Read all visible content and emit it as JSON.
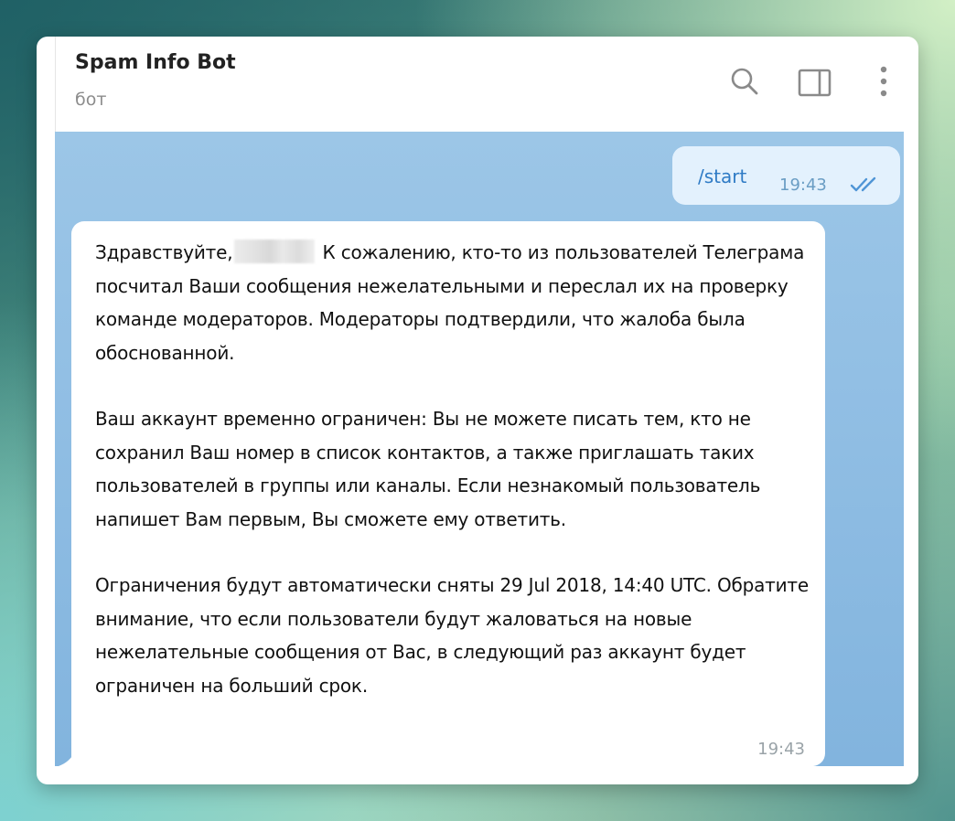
{
  "header": {
    "title": "Spam Info Bot",
    "subtitle": "бот",
    "icons": [
      "search-icon",
      "sidebar-toggle-icon",
      "more-vertical-icon"
    ]
  },
  "messages": {
    "outgoing": {
      "text": "/start",
      "time": "19:43",
      "status_icon": "double-check-icon"
    },
    "incoming": {
      "greeting": "Здравствуйте,",
      "paragraph1_rest": "К сожалению, кто-то из пользователей Телеграма посчитал Ваши сообщения нежелательными и переслал их на проверку команде модераторов. Модераторы подтвердили, что жалоба была обоснованной.",
      "paragraph2": "Ваш аккаунт временно ограничен: Вы не можете писать тем, кто не сохранил Ваш номер в список контактов, а также приглашать таких пользователей в группы или каналы. Если незнакомый пользователь напишет Вам первым, Вы сможете ему ответить.",
      "paragraph3": "Ограничения будут автоматически сняты 29 Jul 2018, 14:40 UTC. Обратите внимание, что если пользователи будут жаловаться на новые нежелательные сообщения от Вас, в следующий раз аккаунт будет ограничен на больший срок.",
      "time": "19:43"
    }
  },
  "colors": {
    "outgoing_bubble": "#e3f1fd",
    "outgoing_text": "#2f7bc5",
    "chat_background": "#8fbde3"
  }
}
